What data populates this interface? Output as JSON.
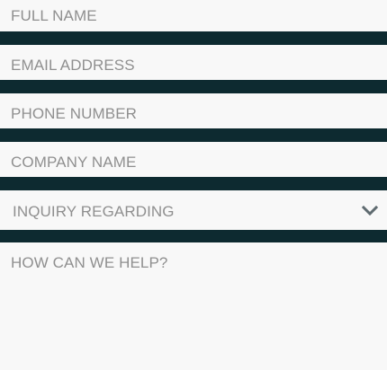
{
  "form": {
    "full_name_placeholder": "FULL NAME",
    "email_placeholder": "EMAIL ADDRESS",
    "phone_placeholder": "PHONE NUMBER",
    "company_placeholder": "COMPANY NAME",
    "inquiry_placeholder": "INQUIRY REGARDING",
    "help_placeholder": "HOW CAN WE HELP?"
  },
  "icons": {
    "dropdown": "chevron-down-icon"
  },
  "colors": {
    "background": "#0d2a30",
    "field": "#f8f8f8",
    "placeholder_text": "#8f8f8f",
    "chevron": "#5f6b70"
  }
}
